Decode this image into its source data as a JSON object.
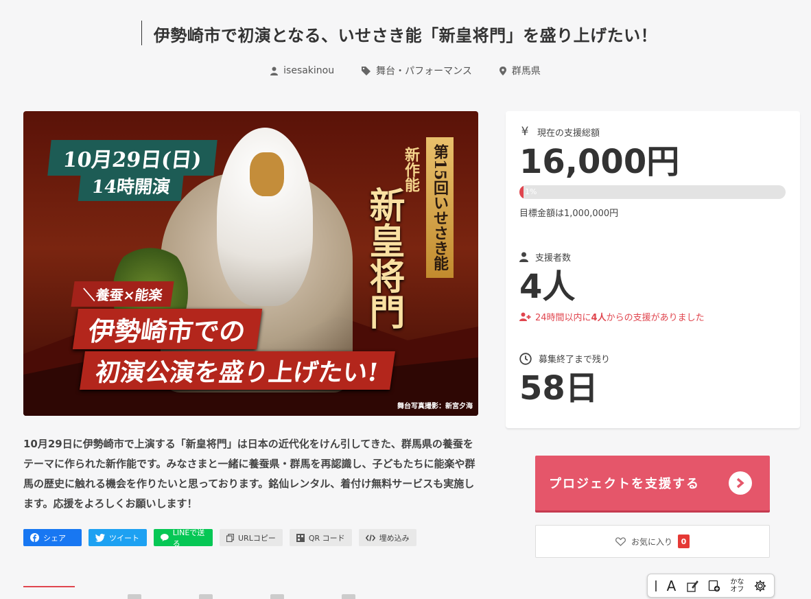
{
  "project": {
    "title": "伊勢崎市で初演となる、いせさき能「新皇将門」を盛り上げたい！",
    "owner": "isesakinou",
    "category": "舞台・パフォーマンス",
    "location": "群馬県"
  },
  "hero": {
    "date": "10月29日(日)",
    "time": "14時開演",
    "series": "第15回いせさき能",
    "new_work": "新作能",
    "play_name": "新皇将門",
    "subtag": "＼養蚕×能楽",
    "banner_line1": "伊勢崎市での",
    "banner_line2": "初演公演を盛り上げたい!",
    "credit": "舞台写真撮影：新宮夕海"
  },
  "description": "10月29日に伊勢崎市で上演する「新皇将門」は日本の近代化をけん引してきた、群馬県の養蚕をテーマに作られた新作能です。みなさまと一緒に養蚕県・群馬を再認識し、子どもたちに能楽や群馬の歴史に触れる機会を作りたいと思っております。銘仙レンタル、着付け無料サービスも実施します。応援をよろしくお願いします！",
  "share": {
    "facebook": "シェア",
    "twitter": "ツイート",
    "line": "LINEで送る",
    "url_copy": "URLコピー",
    "qr": "QR コード",
    "embed": "埋め込み"
  },
  "stats": {
    "total_label": "現在の支援総額",
    "total_value": "16,000円",
    "progress_percent": 1,
    "progress_label": "1%",
    "goal_text": "目標金額は1,000,000円",
    "supporters_label": "支援者数",
    "supporters_value": "4人",
    "recent_prefix": "24時間以内に",
    "recent_count": "4人",
    "recent_suffix": "からの支援がありました",
    "remaining_label": "募集終了まで残り",
    "remaining_value": "58日"
  },
  "actions": {
    "support_label": "プロジェクトを支援する",
    "favorite_label": "お気に入り",
    "favorite_count": "0"
  },
  "ime_toolbar": {
    "mode_glyph": "A",
    "kana_top": "かな",
    "kana_bottom": "オフ"
  },
  "colors": {
    "accent": "#e5566a",
    "badge": "#e53935",
    "facebook": "#1877f2",
    "twitter": "#1da1f2",
    "line": "#06c755"
  }
}
